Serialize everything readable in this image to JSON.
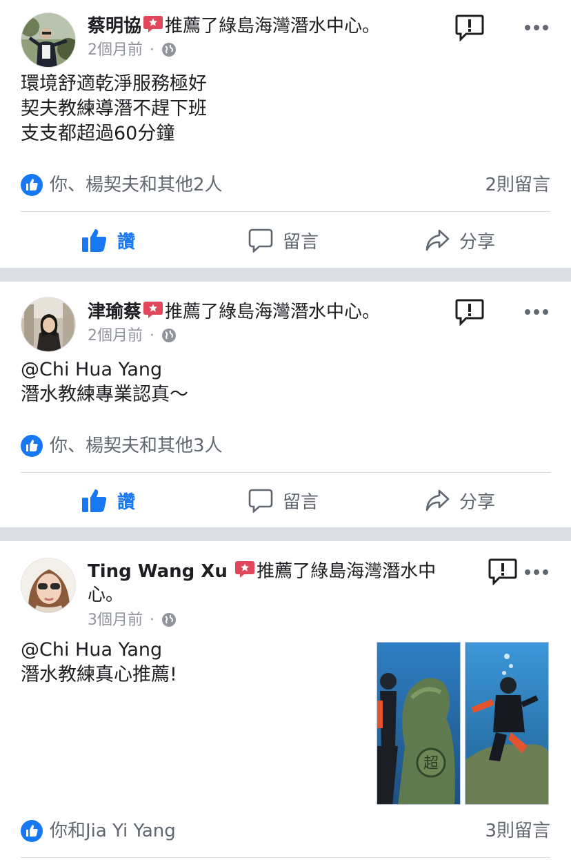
{
  "page_name": "綠島海灣潛水中心",
  "recommend_text": "推薦了綠島海灣潛水中心。",
  "actions": {
    "like": "讚",
    "comment": "留言",
    "share": "分享"
  },
  "colors": {
    "accent": "#1877f2",
    "badge": "#e0475a",
    "separator": "#dadde1"
  },
  "posts": [
    {
      "author": "蔡明協",
      "time": "2個月前",
      "body": "環境舒適乾淨服務極好\n契夫教練導潛不趕下班\n支支都超過60分鐘",
      "likes": "你、楊契夫和其他2人",
      "comments": "2則留言"
    },
    {
      "author": "津瑜蔡",
      "time": "2個月前",
      "body": "@Chi Hua Yang\n潛水教練專業認真～",
      "likes": "你、楊契夫和其他3人",
      "comments": ""
    },
    {
      "author": "Ting Wang Xu",
      "rec_line1": "推薦了綠島海灣潛水中",
      "rec_line2": "心。",
      "time": "3個月前",
      "body": "@Chi Hua Yang\n潛水教練真心推薦!",
      "likes": "你和Jia Yi  Yang",
      "comments": "3則留言",
      "photos": [
        "diver-with-statue-photo",
        "diver-near-rock-photo"
      ]
    }
  ],
  "icons": [
    "recommend-badge-icon",
    "globe-icon",
    "report-icon",
    "more-icon",
    "like-reaction-icon",
    "thumbs-up-icon",
    "comment-icon",
    "share-icon"
  ]
}
